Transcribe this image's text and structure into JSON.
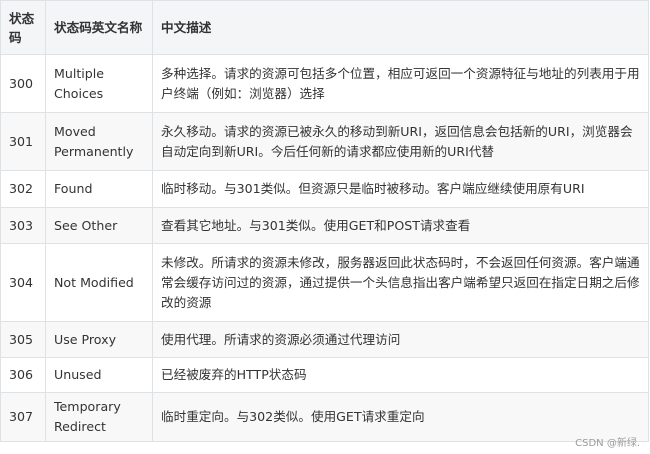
{
  "table": {
    "headers": [
      "状态码",
      "状态码英文名称",
      "中文描述"
    ],
    "rows": [
      {
        "code": "300",
        "name": "Multiple Choices",
        "desc": "多种选择。请求的资源可包括多个位置，相应可返回一个资源特征与地址的列表用于用户终端（例如：浏览器）选择"
      },
      {
        "code": "301",
        "name": "Moved Permanently",
        "desc": "永久移动。请求的资源已被永久的移动到新URI，返回信息会包括新的URI，浏览器会自动定向到新URI。今后任何新的请求都应使用新的URI代替"
      },
      {
        "code": "302",
        "name": "Found",
        "desc": "临时移动。与301类似。但资源只是临时被移动。客户端应继续使用原有URI"
      },
      {
        "code": "303",
        "name": "See Other",
        "desc": "查看其它地址。与301类似。使用GET和POST请求查看"
      },
      {
        "code": "304",
        "name": "Not Modified",
        "desc": "未修改。所请求的资源未修改，服务器返回此状态码时，不会返回任何资源。客户端通常会缓存访问过的资源，通过提供一个头信息指出客户端希望只返回在指定日期之后修改的资源"
      },
      {
        "code": "305",
        "name": "Use Proxy",
        "desc": "使用代理。所请求的资源必须通过代理访问"
      },
      {
        "code": "306",
        "name": "Unused",
        "desc": "已经被废弃的HTTP状态码"
      },
      {
        "code": "307",
        "name": "Temporary Redirect",
        "desc": "临时重定向。与302类似。使用GET请求重定向"
      }
    ]
  },
  "watermark": "CSDN @新绿."
}
